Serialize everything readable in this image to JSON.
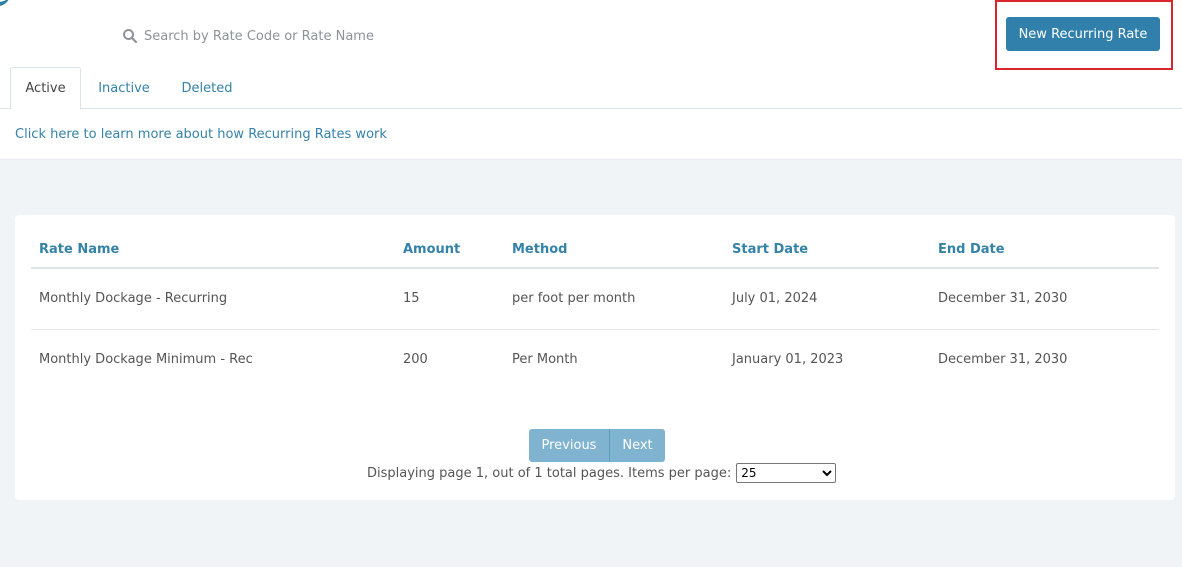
{
  "search": {
    "placeholder": "Search by Rate Code or Rate Name",
    "icon": "search-icon"
  },
  "toolbar": {
    "new_label": "New Recurring Rate"
  },
  "tabs": [
    {
      "label": "Active",
      "active": true
    },
    {
      "label": "Inactive",
      "active": false
    },
    {
      "label": "Deleted",
      "active": false
    }
  ],
  "learn_link": "Click here to learn more about how Recurring Rates work",
  "table": {
    "headers": [
      "Rate Name",
      "Amount",
      "Method",
      "Start Date",
      "End Date"
    ],
    "rows": [
      [
        "Monthly Dockage - Recurring",
        "15",
        "per foot per month",
        "July 01, 2024",
        "December 31, 2030"
      ],
      [
        "Monthly Dockage Minimum - Rec",
        "200",
        "Per Month",
        "January 01, 2023",
        "December 31, 2030"
      ]
    ]
  },
  "pager": {
    "previous": "Previous",
    "next": "Next",
    "info": "Displaying page 1, out of 1 total pages. Items per page:",
    "items_per_page": "25"
  },
  "colors": {
    "accent": "#3080ab",
    "highlight": "#d9262c",
    "link": "#3582a8"
  }
}
